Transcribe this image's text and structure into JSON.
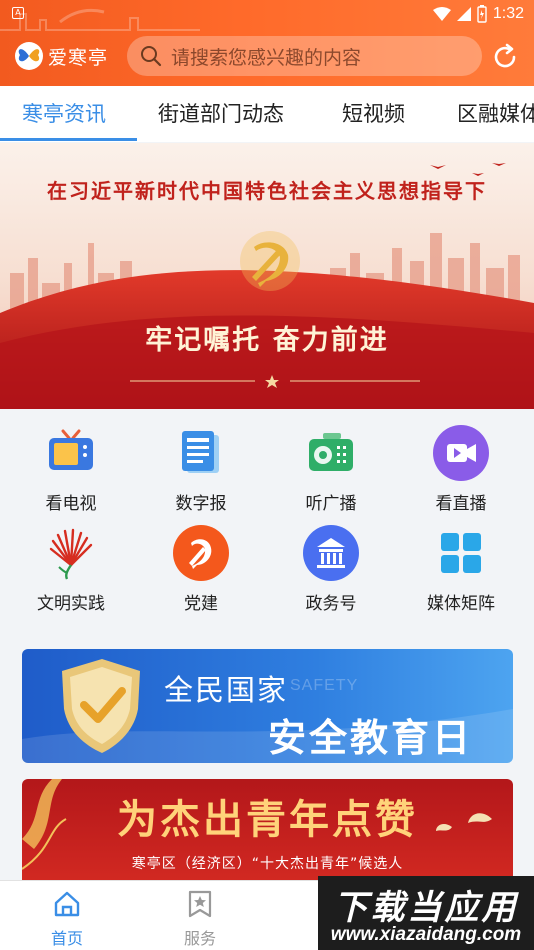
{
  "status_bar": {
    "badge": "A",
    "time": "1:32"
  },
  "header": {
    "app_name": "爱寒亭",
    "search_placeholder": "请搜索您感兴趣的内容",
    "brand_color": "#f25a1f"
  },
  "tabs": [
    {
      "label": "寒亭资讯",
      "active": true
    },
    {
      "label": "街道部门动态",
      "active": false
    },
    {
      "label": "短视频",
      "active": false
    },
    {
      "label": "区融媒体",
      "active": false
    }
  ],
  "banner": {
    "title": "在习近平新时代中国特色社会主义思想指导下",
    "slogan": "牢记嘱托 奋力前进"
  },
  "grid": [
    {
      "label": "看电视",
      "icon": "tv-icon"
    },
    {
      "label": "数字报",
      "icon": "newspaper-icon"
    },
    {
      "label": "听广播",
      "icon": "radio-icon"
    },
    {
      "label": "看直播",
      "icon": "live-video-icon"
    },
    {
      "label": "文明实践",
      "icon": "civilization-fan-icon"
    },
    {
      "label": "党建",
      "icon": "party-emblem-icon"
    },
    {
      "label": "政务号",
      "icon": "government-building-icon"
    },
    {
      "label": "媒体矩阵",
      "icon": "matrix-grid-icon"
    }
  ],
  "promos": {
    "safety": {
      "line1": "全民国家",
      "watermark": "SAFETY",
      "line2": "安全教育日"
    },
    "youth": {
      "title": "为杰出青年点赞",
      "subtitle": "寒亭区（经济区）“十大杰出青年”候选人"
    }
  },
  "bottom_nav": [
    {
      "label": "首页",
      "icon": "home-icon",
      "active": true
    },
    {
      "label": "服务",
      "icon": "bookmark-star-icon",
      "active": false
    }
  ],
  "watermark": {
    "line1": "下载当应用",
    "line2": "www.xiazaidang.com"
  },
  "colors": {
    "accent": "#3a8ee6",
    "party_red": "#c0221c"
  }
}
